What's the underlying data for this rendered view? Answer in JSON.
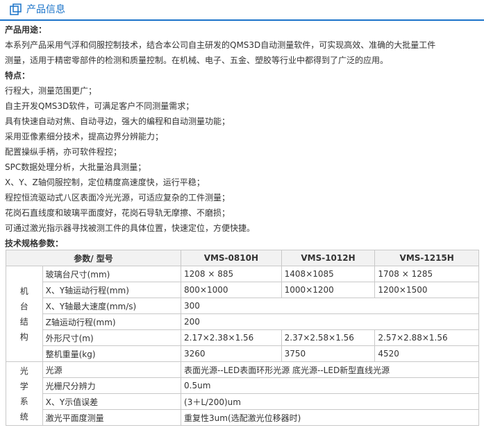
{
  "header": {
    "title": "产品信息"
  },
  "usage": {
    "label": "产品用途：",
    "lines": [
      "本系列产品采用气浮和伺服控制技术，结合本公司自主研发的QMS3D自动测量软件，可实现高效、准确的大批量工件",
      "测量，适用于精密零部件的检测和质量控制。在机械、电子、五金、塑胶等行业中都得到了广泛的应用。"
    ]
  },
  "features": {
    "label": "特点：",
    "items": [
      "行程大，测量范围更广；",
      "自主开发QMS3D软件，可满足客户不同测量需求；",
      "具有快速自动对焦、自动寻边，强大的编程和自动测量功能；",
      "采用亚像素细分技术，提高边界分辨能力；",
      "配置操纵手柄，亦可软件程控；",
      "SPC数据处理分析，大批量治具测量；",
      "X、Y、Z轴伺服控制，定位精度高速度快，运行平稳；",
      "程控恒流驱动式八区表面冷光光源，可适应复杂的工件测量；",
      "花岗石直线度和玻璃平面度好，花岗石导轨无摩擦、不磨损；",
      "可通过激光指示器寻找被测工件的具体位置，快速定位，方便快捷。"
    ]
  },
  "spec": {
    "label": "技术规格参数：",
    "header": [
      "参数/ 型号",
      "VMS-0810H",
      "VMS-1012H",
      "VMS-1215H"
    ],
    "group1": {
      "chars": [
        "机",
        "台",
        "结",
        "构"
      ],
      "rows": [
        [
          "玻璃台尺寸(mm)",
          "1208 × 885",
          "1408×1085",
          "1708 × 1285"
        ],
        [
          "X、Y轴运动行程(mm)",
          "800×1000",
          "1000×1200",
          "1200×1500"
        ],
        [
          "X、Y轴最大速度(mm/s)",
          "300"
        ],
        [
          "Z轴运动行程(mm)",
          "200"
        ],
        [
          "外形尺寸(m)",
          "2.17×2.38×1.56",
          "2.37×2.58×1.56",
          "2.57×2.88×1.56"
        ],
        [
          "整机重量(kg)",
          "3260",
          "3750",
          "4520"
        ]
      ]
    },
    "group2": {
      "chars": [
        "光",
        "学",
        "系",
        "统"
      ],
      "rows": [
        [
          "光源",
          "表面光源--LED表面环形光源 底光源--LED新型直线光源"
        ],
        [
          "光栅尺分辨力",
          "0.5um"
        ],
        [
          "X、Y示值误差",
          "(3＋L/200)um"
        ],
        [
          "激光平面度测量",
          "重复性3um(选配激光位移器时)"
        ]
      ]
    }
  }
}
